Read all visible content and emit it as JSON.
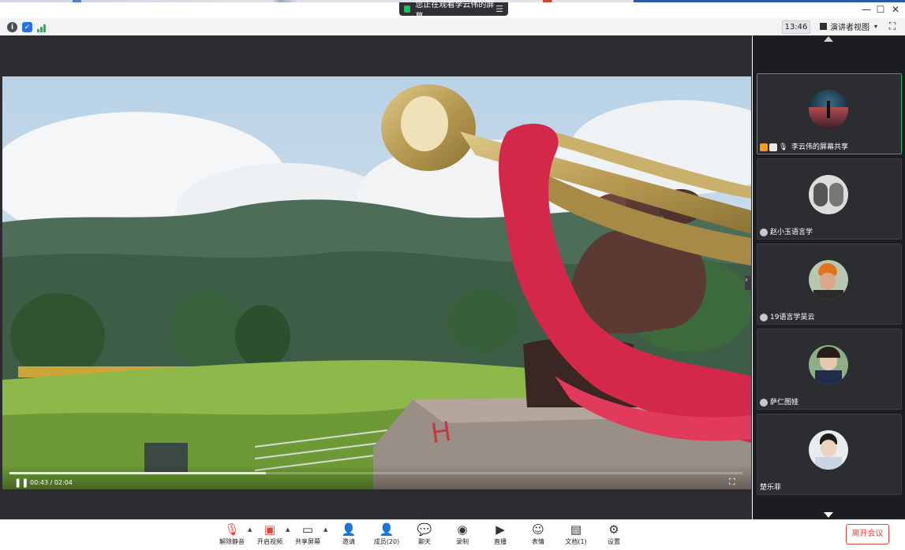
{
  "banner": {
    "text": "您正在观看李云伟的屏幕"
  },
  "infobar": {
    "clock": "13:46",
    "view_label": "演讲者视图"
  },
  "video": {
    "time": "00:43 / 02:04",
    "progress": 0.35
  },
  "participants": [
    {
      "name": "李云伟的屏幕共享",
      "active": true
    },
    {
      "name": "赵小玉语言学",
      "active": false
    },
    {
      "name": "19语言学吴云",
      "active": false
    },
    {
      "name": "萨仁图娅",
      "active": false
    },
    {
      "name": "楚乐菲",
      "active": false
    }
  ],
  "toolbar": {
    "mute": "解除静音",
    "video": "开启视频",
    "share": "共享屏幕",
    "invite": "邀请",
    "members": "成员(20)",
    "chat": "聊天",
    "record": "录制",
    "live": "直播",
    "reactions": "表情",
    "docs": "文档(1)",
    "settings": "设置",
    "leave": "离开会议"
  },
  "colors": {
    "accent": "#29b06d",
    "leave": "#e2453c",
    "panel": "#1c1d20"
  }
}
